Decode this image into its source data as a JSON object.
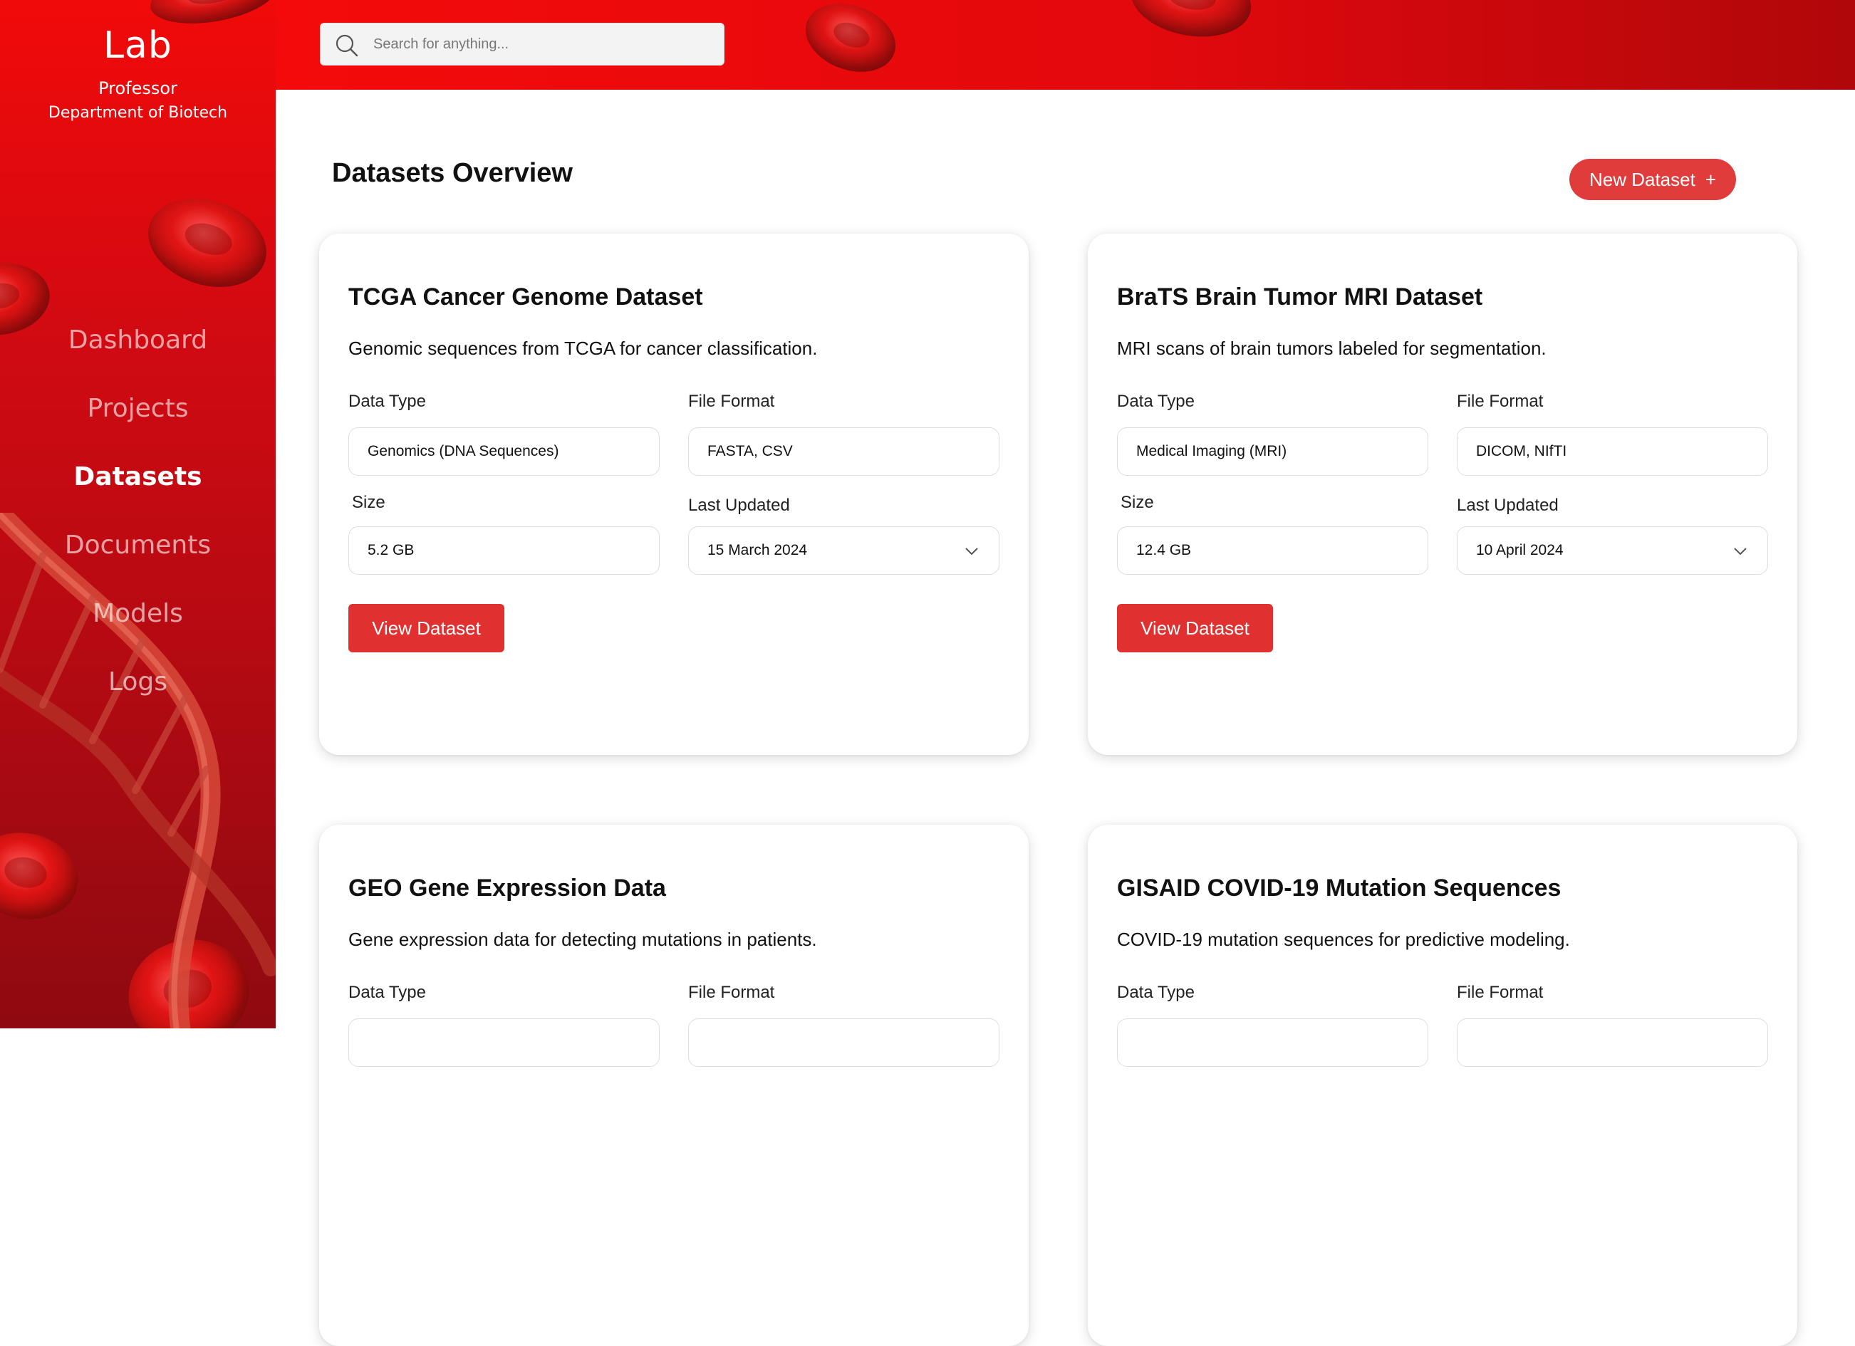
{
  "sidebar": {
    "brand": "Lab",
    "role": "Professor",
    "department": "Department of Biotech",
    "nav": [
      "Dashboard",
      "Projects",
      "Datasets",
      "Documents",
      "Models",
      "Logs"
    ],
    "active": "Datasets"
  },
  "header": {
    "search_placeholder": "Search for anything..."
  },
  "main": {
    "title": "Datasets Overview",
    "new_button": "New Dataset",
    "new_button_icon": "+",
    "labels": {
      "data_type": "Data Type",
      "file_format": "File Format",
      "size": "Size",
      "last_updated": "Last Updated",
      "view_button": "View Dataset"
    },
    "cards": [
      {
        "title": "TCGA Cancer Genome Dataset",
        "description": "Genomic sequences from TCGA for cancer classification.",
        "data_type": "Genomics (DNA Sequences)",
        "file_format": "FASTA, CSV",
        "size": "5.2 GB",
        "last_updated": "15 March 2024"
      },
      {
        "title": "BraTS Brain Tumor MRI Dataset",
        "description": "MRI scans of brain tumors labeled for segmentation.",
        "data_type": "Medical Imaging (MRI)",
        "file_format": "DICOM, NIfTI",
        "size": "12.4 GB",
        "last_updated": "10 April 2024"
      },
      {
        "title": "GEO Gene Expression Data",
        "description": "Gene expression data for detecting mutations in patients."
      },
      {
        "title": "GISAID COVID-19 Mutation Sequences",
        "description": "COVID-19 mutation sequences for predictive modeling."
      }
    ]
  },
  "colors": {
    "brand_red": "#e60a0a",
    "button_red": "#e03030",
    "text": "#111111"
  },
  "icons": [
    "search-icon",
    "plus-icon",
    "chevron-down-icon",
    "red-blood-cell",
    "dna-helix"
  ]
}
